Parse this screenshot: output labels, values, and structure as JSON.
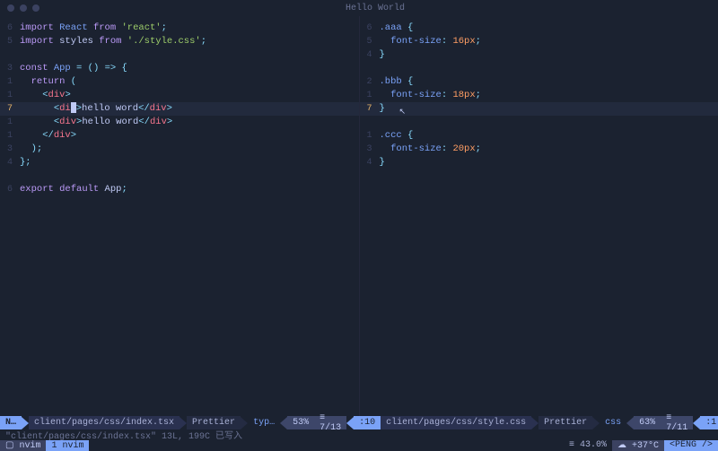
{
  "titlebar": {
    "title": "Hello World"
  },
  "left": {
    "lines": [
      {
        "rel": "6",
        "html": "<span class='kw'>import</span> <span class='id'>React</span> <span class='kw'>from</span> <span class='str'>'react'</span><span class='punc'>;</span>"
      },
      {
        "rel": "5",
        "html": "<span class='kw'>import</span> <span class='var'>styles</span> <span class='kw'>from</span> <span class='str'>'./style.css'</span><span class='punc'>;</span>"
      },
      {
        "rel": "",
        "html": ""
      },
      {
        "rel": "3",
        "html": "<span class='kw'>const</span> <span class='fn'>App</span> <span class='op'>=</span> <span class='punc'>()</span> <span class='op'>=&gt;</span> <span class='punc'>{</span>"
      },
      {
        "rel": "1",
        "html": "  <span class='kw'>return</span> <span class='punc'>(</span>"
      },
      {
        "rel": "1",
        "html": "    <span class='punc'>&lt;</span><span class='tag'>div</span><span class='punc'>&gt;</span>"
      },
      {
        "rel": "7",
        "current": true,
        "html": "      <span class='punc'>&lt;</span><span class='tag'>di</span><span class='cursor'></span><span class='punc'>&gt;</span><span class='def'>hello word</span><span class='punc'>&lt;/</span><span class='tag'>div</span><span class='punc'>&gt;</span>"
      },
      {
        "rel": "1",
        "html": "      <span class='punc'>&lt;</span><span class='tag'>div</span><span class='punc'>&gt;</span><span class='def'>hello word</span><span class='punc'>&lt;/</span><span class='tag'>div</span><span class='punc'>&gt;</span>"
      },
      {
        "rel": "1",
        "html": "    <span class='punc'>&lt;/</span><span class='tag'>div</span><span class='punc'>&gt;</span>"
      },
      {
        "rel": "3",
        "html": "  <span class='punc'>);</span>"
      },
      {
        "rel": "4",
        "html": "<span class='punc'>};</span>"
      },
      {
        "rel": "",
        "html": ""
      },
      {
        "rel": "6",
        "html": "<span class='kw'>export</span> <span class='kw'>default</span> <span class='var'>App</span><span class='punc'>;</span>"
      }
    ],
    "status": {
      "mode": "N…",
      "file": "client/pages/css/index.tsx",
      "fmt": "Prettier",
      "ft": "typ…",
      "pct": "53%",
      "lines": "≡ 7/13",
      "col": ":10"
    }
  },
  "right": {
    "lines": [
      {
        "rel": "6",
        "html": "<span class='id'>.aaa</span> <span class='punc'>{</span>"
      },
      {
        "rel": "5",
        "html": "  <span class='prop'>font-size</span><span class='punc'>:</span> <span class='num'>16px</span><span class='punc'>;</span>"
      },
      {
        "rel": "4",
        "html": "<span class='punc'>}</span>"
      },
      {
        "rel": "",
        "html": ""
      },
      {
        "rel": "2",
        "html": "<span class='id'>.bbb</span> <span class='punc'>{</span>"
      },
      {
        "rel": "1",
        "html": "  <span class='prop'>font-size</span><span class='punc'>:</span> <span class='num'>18px</span><span class='punc'>;</span>"
      },
      {
        "rel": "7",
        "current": true,
        "html": "<span class='punc'>}</span>"
      },
      {
        "rel": "",
        "html": ""
      },
      {
        "rel": "1",
        "html": "<span class='id'>.ccc</span> <span class='punc'>{</span>"
      },
      {
        "rel": "3",
        "html": "  <span class='prop'>font-size</span><span class='punc'>:</span> <span class='num'>20px</span><span class='punc'>;</span>"
      },
      {
        "rel": "4",
        "html": "<span class='punc'>}</span>"
      }
    ],
    "status": {
      "file": "client/pages/css/style.css",
      "fmt": "Prettier",
      "ft": "css",
      "pct": "63%",
      "lines": "≡ 7/11",
      "col": ":1"
    }
  },
  "message": "\"client/pages/css/index.tsx\" 13L, 199C 已写入",
  "tmux": {
    "session": "▢ nvim",
    "window": "1 nvim",
    "pct": "≡ 43.0%",
    "weather": "☁ +37°C",
    "host": "<PENG />"
  }
}
